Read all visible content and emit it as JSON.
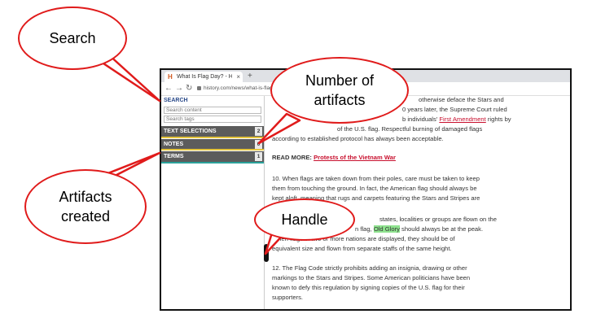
{
  "browser": {
    "tab_title": "What Is Flag Day? - HISTO",
    "tab_close": "×",
    "new_tab": "+",
    "back_icon": "arrow-left-icon",
    "forward_icon": "arrow-right-icon",
    "reload_icon": "reload-icon",
    "url": "history.com/news/what-is-flag-"
  },
  "sidebar": {
    "title": "SEARCH",
    "search_content_placeholder": "Search content",
    "search_tags_placeholder": "Search tags",
    "rows": [
      {
        "label": "TEXT SELECTIONS",
        "count": "2"
      },
      {
        "label": "NOTES",
        "count": "0"
      },
      {
        "label": "TERMS",
        "count": "1"
      }
    ]
  },
  "article": {
    "p1_line1": "otherwise deface the Stars and",
    "p1_line2": "0 years later, the Supreme Court ruled",
    "p1_line3a": "b individuals'",
    "p1_link": "First Amendment",
    "p1_line3b": "rights by",
    "p1_line4": "of the U.S. flag. Respectful burning of damaged flags",
    "p1_line5": "according to established protocol has always been acceptable.",
    "read_more_label": "READ MORE:",
    "read_more_link": "Protests of the Vietnam War",
    "p2_line1": "10. When flags are taken down from their poles, care must be taken to keep",
    "p2_line2": "them from touching the ground. In fact, the American flag should always be",
    "p2_line3": "kept aloft, meaning that rugs and carpets featuring the Stars and Stripes are",
    "p3_line1": "states, localities or groups are flown on the",
    "p3_line2a": "n flag,",
    "p3_highlight": "Old Glory",
    "p3_line2b": "should always be at the peak.",
    "p3_line3": "When flags of two or more nations are displayed, they should be of",
    "p3_line4": "equivalent size and flown from separate staffs of the same height.",
    "p4_line1": "12. The Flag Code strictly prohibits adding an insignia, drawing or other",
    "p4_line2": "markings to the Stars and Stripes. Some American politicians have been",
    "p4_line3": "known to defy this regulation by signing copies of the U.S. flag for their",
    "p4_line4": "supporters."
  },
  "handle": {
    "glyph": "«"
  },
  "callouts": {
    "search": "Search",
    "artifacts_line1": "Number of",
    "artifacts_line2": "artifacts",
    "created_line1": "Artifacts",
    "created_line2": "created",
    "handle": "Handle"
  },
  "colors": {
    "callout_border": "#e01b1b",
    "row_background": "#5c5c5c",
    "text_selection_accent": "#e5c53c",
    "terms_accent": "#2aa19a",
    "link": "#c8102e",
    "highlight": "#8fe38f"
  }
}
